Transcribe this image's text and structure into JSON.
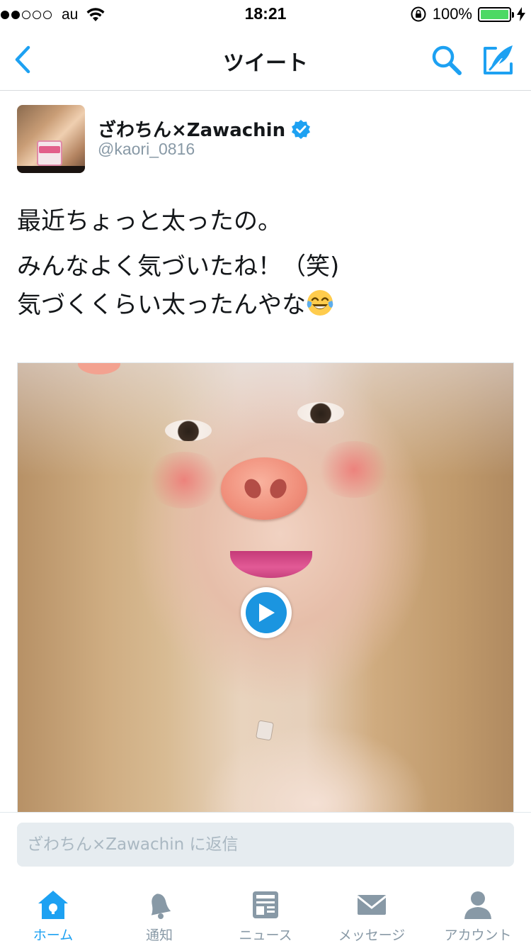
{
  "status_bar": {
    "carrier": "au",
    "time": "18:21",
    "battery": "100%"
  },
  "nav": {
    "title": "ツイート",
    "icons": [
      "back-chevron-icon",
      "search-icon",
      "compose-tweet-icon"
    ]
  },
  "tweet": {
    "author_name": "ざわちん×Zawachin",
    "handle": "@kaori_0816",
    "verified": true,
    "text_line_1": "最近ちょっと太ったの。",
    "text_line_2": "みんなよく気づいたね！（笑)",
    "text_line_3": "気づくくらい太ったんやな",
    "emoji": "face-with-tears-of-joy",
    "media": {
      "type": "video",
      "icon": "play-icon"
    }
  },
  "reply": {
    "placeholder": "ざわちん×Zawachin に返信"
  },
  "tabs": [
    {
      "label": "ホーム",
      "icon": "home-icon",
      "active": true
    },
    {
      "label": "通知",
      "icon": "bell-icon",
      "active": false
    },
    {
      "label": "ニュース",
      "icon": "news-icon",
      "active": false
    },
    {
      "label": "メッセージ",
      "icon": "envelope-icon",
      "active": false
    },
    {
      "label": "アカウント",
      "icon": "person-icon",
      "active": false
    }
  ],
  "colors": {
    "accent": "#1da1f2",
    "text": "#14171a",
    "muted": "#8899a6",
    "battery": "#4cd964"
  }
}
